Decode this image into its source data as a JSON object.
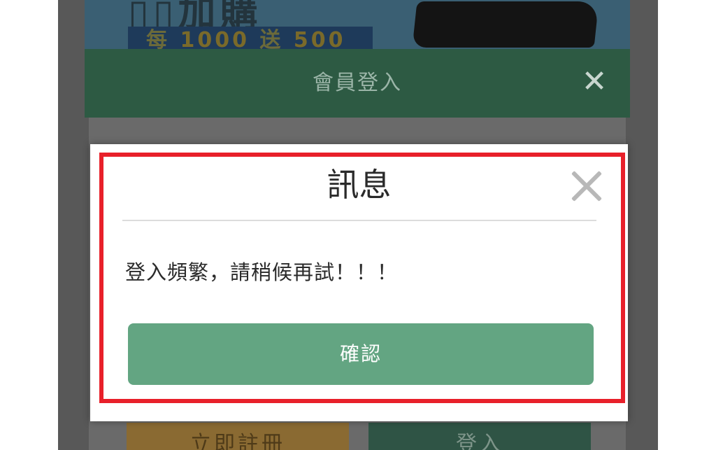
{
  "colors": {
    "login_header": "#2d5a43",
    "confirm_button": "#63a582",
    "register_button": "#8a6a32",
    "highlight": "#e8202a",
    "overlay": "#585858"
  },
  "banner": {
    "title": "▯▯加購",
    "promo_prefix": "每",
    "promo_amount": "1000",
    "promo_mid": "送",
    "promo_bonus": "500"
  },
  "login_modal": {
    "title": "會員登入",
    "close_icon": "close-icon",
    "register_label": "立即註冊",
    "login_label": "登入"
  },
  "dialog": {
    "title": "訊息",
    "close_icon": "close-icon",
    "message": "登入頻繁，請稍候再試！！！",
    "confirm_label": "確認"
  }
}
